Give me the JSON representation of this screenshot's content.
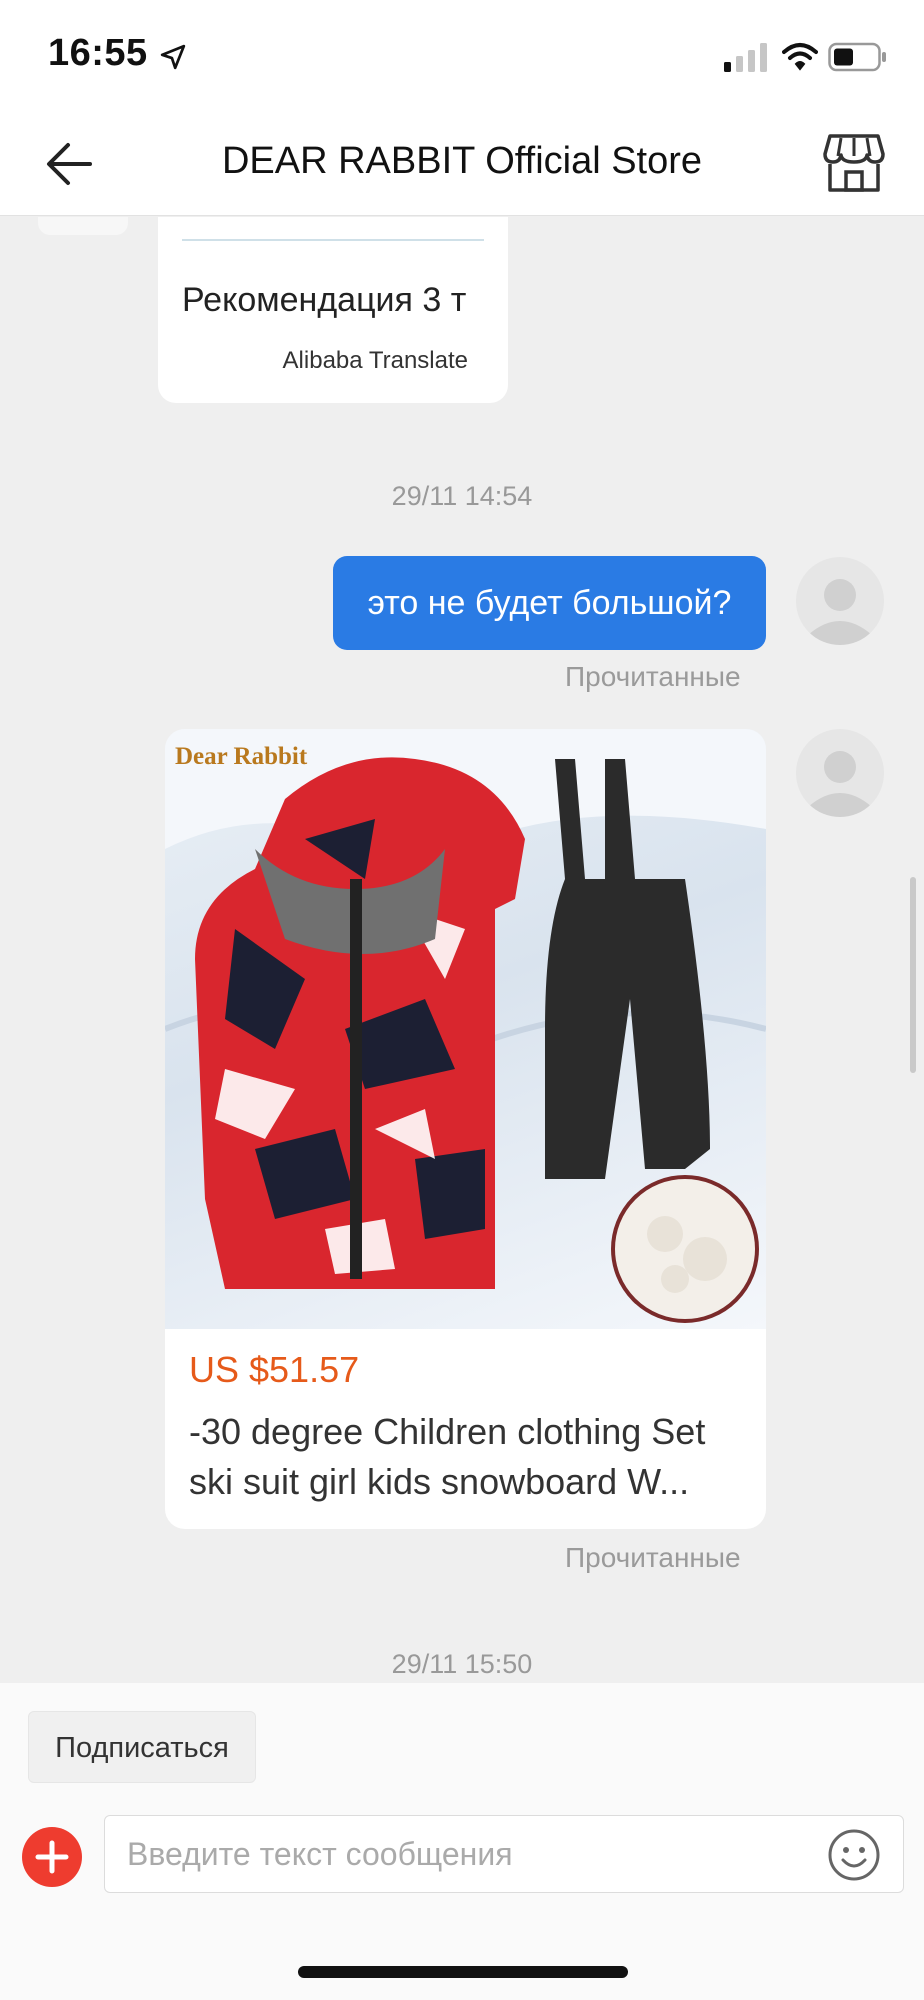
{
  "status_bar": {
    "time": "16:55"
  },
  "header": {
    "title": "DEAR RABBIT Official Store"
  },
  "messages": {
    "incoming_text": "Рекомендация 3 т",
    "incoming_source": "Alibaba Translate",
    "timestamp_1": "29/11 14:54",
    "outgoing_text": "это не будет большой?",
    "read_status": "Прочитанные",
    "product": {
      "brand": "Dear Rabbit",
      "price": "US $51.57",
      "title": "-30 degree Children clothing Set ski suit girl kids snowboard W..."
    },
    "read_status_2": "Прочитанные",
    "timestamp_2": "29/11 15:50"
  },
  "bottom": {
    "subscribe_label": "Подписаться",
    "input_placeholder": "Введите текст сообщения"
  },
  "colors": {
    "outgoing_bubble": "#2a7be4",
    "price": "#e65a1a",
    "plus_button": "#ee3c2f",
    "gift": "#f5a623"
  }
}
